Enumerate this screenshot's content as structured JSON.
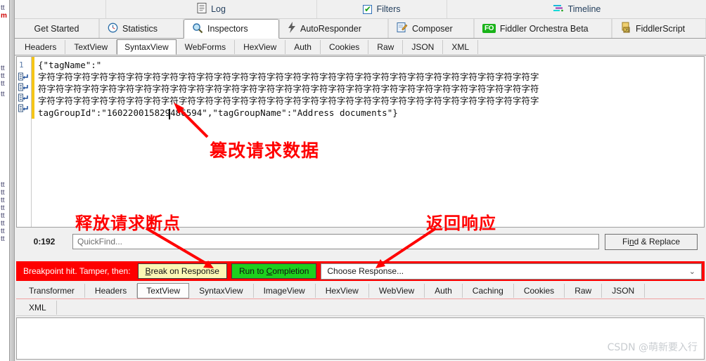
{
  "app": "Fiddler",
  "toolbar_row1": [
    {
      "label": "Log",
      "icon": "log-icon"
    },
    {
      "label": "Filters",
      "icon": "checkbox-checked-icon"
    },
    {
      "label": "Timeline",
      "icon": "timeline-icon"
    }
  ],
  "main_tabs": [
    {
      "label": "Get Started",
      "icon": "none",
      "active": false
    },
    {
      "label": "Statistics",
      "icon": "clock-icon",
      "active": false
    },
    {
      "label": "Inspectors",
      "icon": "magnifier-icon",
      "active": true
    },
    {
      "label": "AutoResponder",
      "icon": "bolt-icon",
      "active": false
    },
    {
      "label": "Composer",
      "icon": "compose-pencil-icon",
      "active": false
    },
    {
      "label": "Fiddler Orchestra Beta",
      "icon": "fo-badge-icon",
      "active": false
    },
    {
      "label": "FiddlerScript",
      "icon": "script-icon",
      "active": false
    }
  ],
  "request_tabs": [
    {
      "label": "Headers",
      "active": false
    },
    {
      "label": "TextView",
      "active": false
    },
    {
      "label": "SyntaxView",
      "active": true
    },
    {
      "label": "WebForms",
      "active": false
    },
    {
      "label": "HexView",
      "active": false
    },
    {
      "label": "Auth",
      "active": false
    },
    {
      "label": "Cookies",
      "active": false
    },
    {
      "label": "Raw",
      "active": false
    },
    {
      "label": "JSON",
      "active": false
    },
    {
      "label": "XML",
      "active": false
    }
  ],
  "editor": {
    "line_number": "1",
    "lines": [
      "{\"tagName\":\"",
      "字符字符字符字符字符字符字符字符字符字符字符字符字符字符字符字符字符字符字符字符字符字符字符字符字符字符字符字符字",
      "符字符字符字符字符字符字符字符字符字符字符字符字符字符字符字符字符字符字符字符字符字符字符字符字符字符字符字符字符",
      "字符字符字符字符字符字符字符字符字符字符字符字符字符字符字符字符字符字符字符字符字符字符字符字符字符字符字符字符字",
      "tagGroupId\":\"160220015829486594\",\"tagGroupName\":\"Address documents\"}"
    ]
  },
  "quickfind": {
    "count_label": "0:192",
    "placeholder": "QuickFind...",
    "value": "",
    "find_replace_label": "Find & Replace",
    "find_replace_accel": "n"
  },
  "breakpoint": {
    "message": "Breakpoint hit. Tamper, then:",
    "break_on_response": "Break on Response",
    "break_on_response_accel": "B",
    "run_to_completion": "Run to Completion",
    "run_to_completion_accel": "C",
    "choose_response": "Choose Response...",
    "bar_color": "#fe0000",
    "yellow_btn_color": "#fbf7b5",
    "green_btn_color": "#1ed01e"
  },
  "response_tabs": [
    {
      "label": "Transformer",
      "active": false
    },
    {
      "label": "Headers",
      "active": false
    },
    {
      "label": "TextView",
      "active": true
    },
    {
      "label": "SyntaxView",
      "active": false
    },
    {
      "label": "ImageView",
      "active": false
    },
    {
      "label": "HexView",
      "active": false
    },
    {
      "label": "WebView",
      "active": false
    },
    {
      "label": "Auth",
      "active": false
    },
    {
      "label": "Caching",
      "active": false
    },
    {
      "label": "Cookies",
      "active": false
    },
    {
      "label": "Raw",
      "active": false
    },
    {
      "label": "JSON",
      "active": false
    }
  ],
  "response_tabs_row2": [
    {
      "label": "XML",
      "active": false
    }
  ],
  "annotations": [
    {
      "id": "tamper",
      "text": "篡改请求数据",
      "color": "#ff0000"
    },
    {
      "id": "release",
      "text": "释放请求断点",
      "color": "#ff0000"
    },
    {
      "id": "return",
      "text": "返回响应",
      "color": "#ff0000"
    }
  ],
  "left_sliver_rows": [
    "tt",
    "m",
    "",
    "",
    "tt",
    "tt",
    "tt",
    "tt",
    "",
    "tt",
    "tt",
    "tt",
    "tt",
    "tt",
    "tt",
    "tt",
    "tt"
  ],
  "watermark": "CSDN @萌新要入行"
}
